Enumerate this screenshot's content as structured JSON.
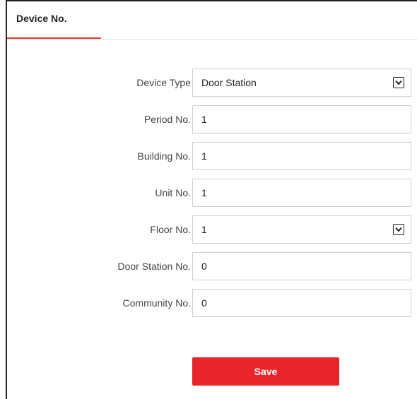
{
  "tabs": [
    {
      "label": "Device No.",
      "active": true
    }
  ],
  "form": {
    "device_type": {
      "label": "Device Type",
      "value": "Door Station"
    },
    "period_no": {
      "label": "Period No.",
      "value": "1"
    },
    "building_no": {
      "label": "Building No.",
      "value": "1"
    },
    "unit_no": {
      "label": "Unit No.",
      "value": "1"
    },
    "floor_no": {
      "label": "Floor No.",
      "value": "1"
    },
    "door_station_no": {
      "label": "Door Station No.",
      "value": "0"
    },
    "community_no": {
      "label": "Community No.",
      "value": "0"
    }
  },
  "actions": {
    "save_label": "Save"
  },
  "colors": {
    "accent": "#e8252a",
    "tab_underline": "#e53935"
  }
}
